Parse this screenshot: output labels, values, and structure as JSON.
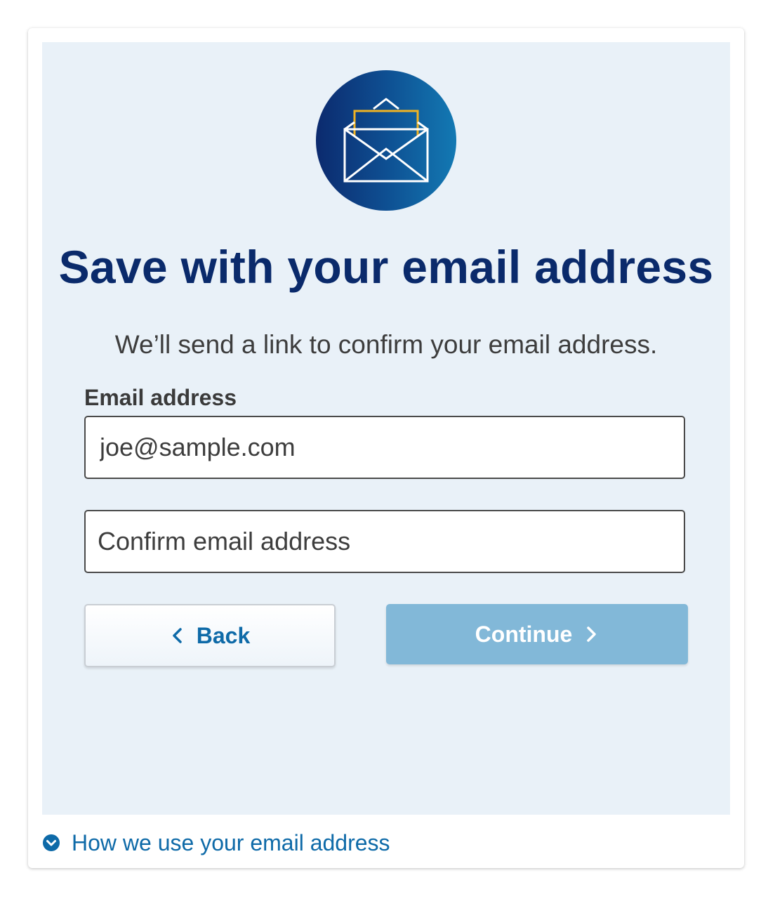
{
  "header": {
    "icon": "open-envelope-icon",
    "title": "Save with your email address",
    "subtitle": "We’ll send a link to confirm your email address."
  },
  "form": {
    "email_label": "Email address",
    "email_value": "joe@sample.com",
    "confirm_placeholder": "Confirm email address",
    "confirm_value": ""
  },
  "buttons": {
    "back_label": "Back",
    "back_icon": "chevron-left-icon",
    "continue_label": "Continue",
    "continue_icon": "chevron-right-icon",
    "continue_state": "disabled"
  },
  "footer": {
    "link_label": "How we use your email address",
    "link_icon": "chevron-down-circle-icon"
  },
  "colors": {
    "title": "#0a2a6b",
    "panel_background": "#e9f1f8",
    "link": "#0e6aa8",
    "continue_button": "#82b8d8",
    "icon_gradient_start": "#0c2a6e",
    "icon_gradient_end": "#1379b3",
    "envelope_letter_accent": "#f0b323"
  }
}
